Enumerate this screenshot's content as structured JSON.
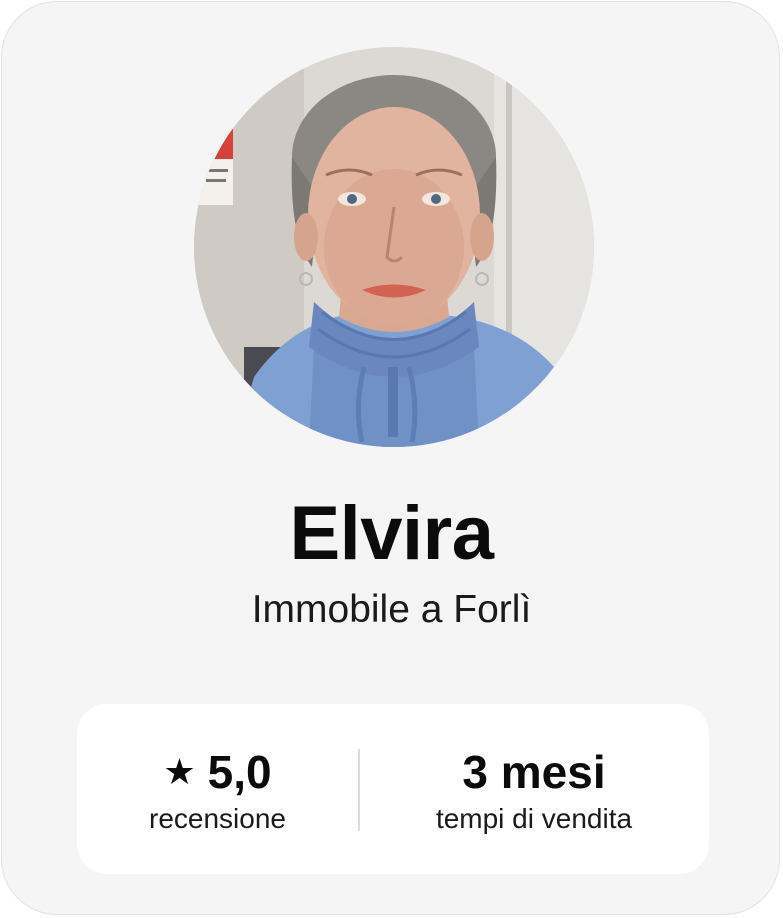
{
  "profile": {
    "name": "Elvira",
    "subtitle": "Immobile a Forlì",
    "avatar_icon": "profile-photo"
  },
  "stats": {
    "rating": {
      "icon": "star-icon",
      "star_glyph": "★",
      "value": "5,0",
      "label": "recensione"
    },
    "sale_time": {
      "value": "3 mesi",
      "label": "tempi di vendita"
    }
  },
  "colors": {
    "card_background": "#f5f5f5",
    "stats_background": "#ffffff",
    "text": "#0b0b0b"
  }
}
